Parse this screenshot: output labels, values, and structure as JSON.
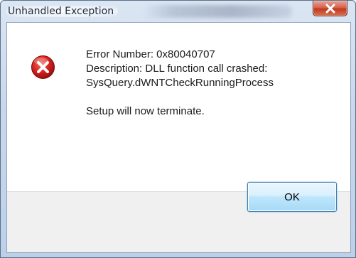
{
  "window": {
    "title": "Unhandled Exception"
  },
  "message": {
    "lines": [
      "Error Number: 0x80040707",
      "Description: DLL function call crashed:",
      "SysQuery.dWNTCheckRunningProcess",
      "Setup will now terminate."
    ]
  },
  "buttons": {
    "ok_label": "OK"
  },
  "icons": {
    "close": "close-icon",
    "error": "error-icon"
  },
  "colors": {
    "close_button": "#c7432a",
    "error_icon": "#c81818",
    "ok_border": "#3c7fb1"
  }
}
